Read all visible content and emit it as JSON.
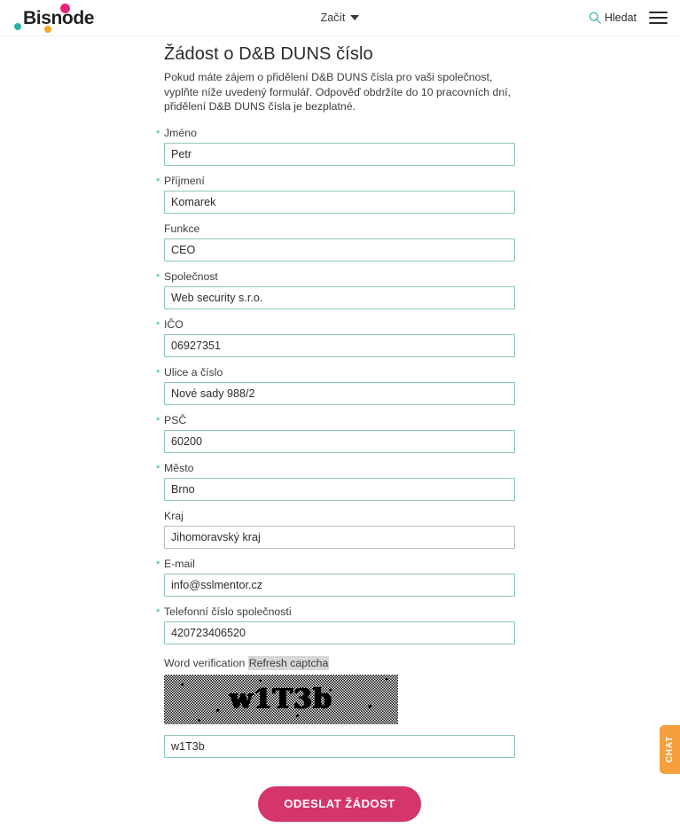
{
  "header": {
    "logo_text": "Bisnode",
    "logo_dot_colors": {
      "pink": "#e3257c",
      "teal": "#2ab3a6",
      "orange": "#f5a623"
    },
    "nav_center_label": "Začít",
    "search_label": "Hledat",
    "search_icon": "search-icon",
    "menu_icon": "hamburger-menu-icon",
    "caret_icon": "chevron-down-icon"
  },
  "main": {
    "title": "Žádost o D&B DUNS číslo",
    "intro": "Pokud máte zájem o přidělení D&B DUNS čísla pro vaši společnost, vyplňte níže uvedený formulář. Odpověď obdržíte do 10 pracovních dní, přidělení D&B DUNS čísla je bezplatné."
  },
  "form": {
    "fields": [
      {
        "name": "jmeno",
        "label": "Jméno",
        "value": "Petr",
        "required": true,
        "style": "teal"
      },
      {
        "name": "prijmeni",
        "label": "Příjmení",
        "value": "Komarek",
        "required": true,
        "style": "teal"
      },
      {
        "name": "funkce",
        "label": "Funkce",
        "value": "CEO",
        "required": false,
        "style": "teal"
      },
      {
        "name": "spolecnost",
        "label": "Společnost",
        "value": "Web security s.r.o.",
        "required": true,
        "style": "teal"
      },
      {
        "name": "ico",
        "label": "IČO",
        "value": "06927351",
        "required": true,
        "style": "teal"
      },
      {
        "name": "ulice",
        "label": "Ulice a číslo",
        "value": "Nové sady 988/2",
        "required": true,
        "style": "teal"
      },
      {
        "name": "psc",
        "label": "PSČ",
        "value": "60200",
        "required": true,
        "style": "teal"
      },
      {
        "name": "mesto",
        "label": "Město",
        "value": "Brno",
        "required": true,
        "style": "teal"
      },
      {
        "name": "kraj",
        "label": "Kraj",
        "value": "Jihomoravský kraj",
        "required": false,
        "style": "neutral"
      },
      {
        "name": "email",
        "label": "E-mail",
        "value": "info@sslmentor.cz",
        "required": true,
        "style": "teal"
      },
      {
        "name": "telefon",
        "label": "Telefonní číslo společnosti",
        "value": "420723406520",
        "required": true,
        "style": "teal"
      }
    ],
    "captcha": {
      "word_verification_label": "Word verification",
      "refresh_label": "Refresh captcha",
      "image_text": "w1T3b",
      "input_value": "w1T3b"
    },
    "submit_label": "ODESLAT ŽÁDOST",
    "submit_color": "#d4356c",
    "required_marker": "*",
    "required_marker_color": "#2ab3a6",
    "input_border_color": "#8bc6bd"
  },
  "chat_widget": {
    "label": "CHAT",
    "color": "#f5a03c"
  }
}
